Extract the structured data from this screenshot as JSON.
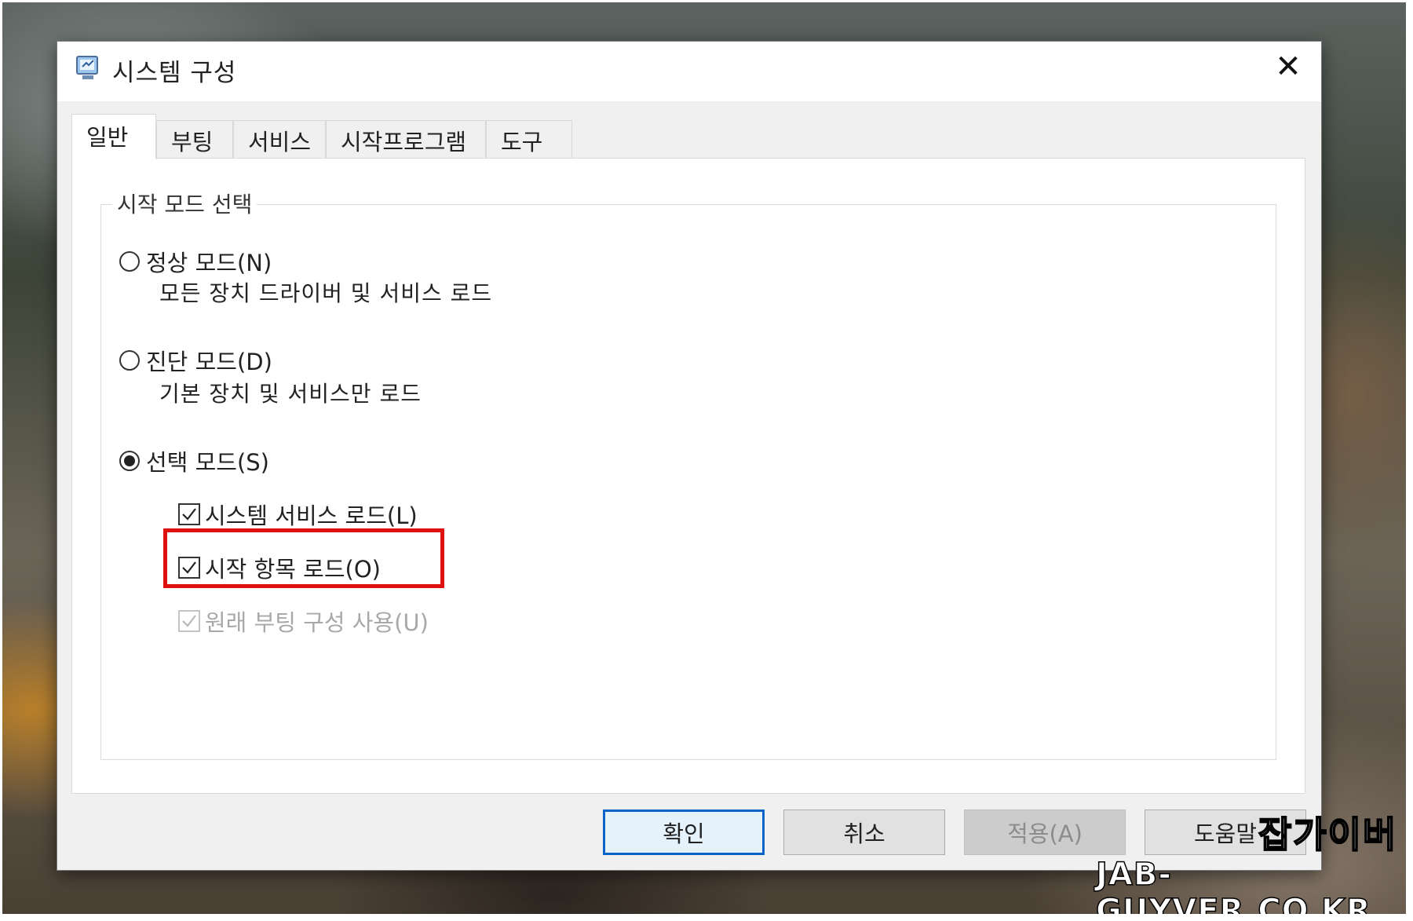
{
  "window": {
    "title": "시스템 구성",
    "close_glyph": "✕"
  },
  "tabs": [
    {
      "label": "일반",
      "active": true
    },
    {
      "label": "부팅",
      "active": false
    },
    {
      "label": "서비스",
      "active": false
    },
    {
      "label": "시작프로그램",
      "active": false
    },
    {
      "label": "도구",
      "active": false
    }
  ],
  "startup_selection": {
    "legend": "시작 모드 선택",
    "normal": {
      "label": "정상 모드(N)",
      "description": "모든 장치 드라이버 및 서비스 로드",
      "selected": false
    },
    "diagnostic": {
      "label": "진단 모드(D)",
      "description": "기본 장치 및 서비스만 로드",
      "selected": false
    },
    "selective": {
      "label": "선택 모드(S)",
      "selected": true
    },
    "options": {
      "load_system_services": {
        "label": "시스템 서비스 로드(L)",
        "checked": true,
        "enabled": true
      },
      "load_startup_items": {
        "label": "시작 항목 로드(O)",
        "checked": true,
        "enabled": true,
        "highlighted": true
      },
      "use_original_boot_config": {
        "label": "원래 부팅 구성 사용(U)",
        "checked": true,
        "enabled": false
      }
    }
  },
  "buttons": {
    "ok": "확인",
    "cancel": "취소",
    "apply": "적용(A)",
    "help": "도움말"
  },
  "watermark": {
    "name": "잡가이버",
    "site": "JAB-GUYVER.CO.KR"
  },
  "colors": {
    "highlight": "#e01010",
    "default_button_border": "#0a64c8"
  }
}
